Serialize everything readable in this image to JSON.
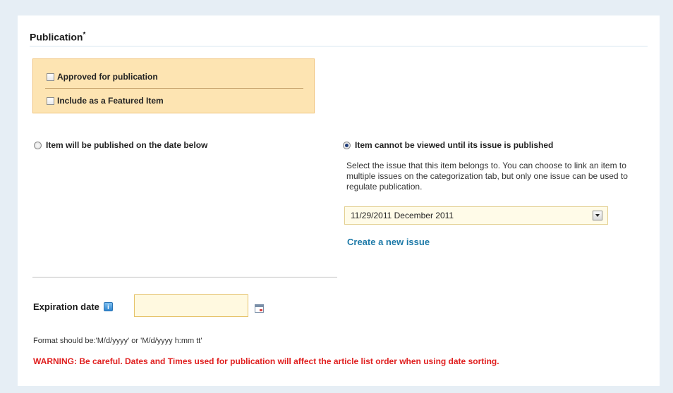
{
  "section": {
    "title": "Publication",
    "required_mark": "*"
  },
  "publication_options": {
    "approved_label": "Approved for publication",
    "featured_label": "Include as a Featured Item",
    "approved_checked": false,
    "featured_checked": false
  },
  "publish_mode": {
    "date_option_label": "Item will be published on the date below",
    "issue_option_label": "Item cannot be viewed until its issue is published",
    "selected": "issue"
  },
  "issue": {
    "help_text": "Select the issue that this item belongs to. You can choose to link an item to multiple issues on the categorization tab, but only one issue can be used to regulate publication.",
    "selected_value": "11/29/2011 December 2011",
    "create_link": "Create a new issue"
  },
  "expiration": {
    "label": "Expiration date",
    "info_icon_glyph": "i",
    "value": "",
    "format_text": "Format should be:'M/d/yyyy' or 'M/d/yyyy h:mm tt'"
  },
  "warning": "WARNING: Be careful. Dates and Times used for publication will affect the article list order when using date sorting.",
  "colors": {
    "warning": "#e02020",
    "link": "#1e7aa8",
    "highlight_box": "#fde4b2"
  },
  "icons": {
    "info": "info-icon",
    "calendar": "calendar-icon",
    "dropdown": "chevron-down-icon"
  }
}
